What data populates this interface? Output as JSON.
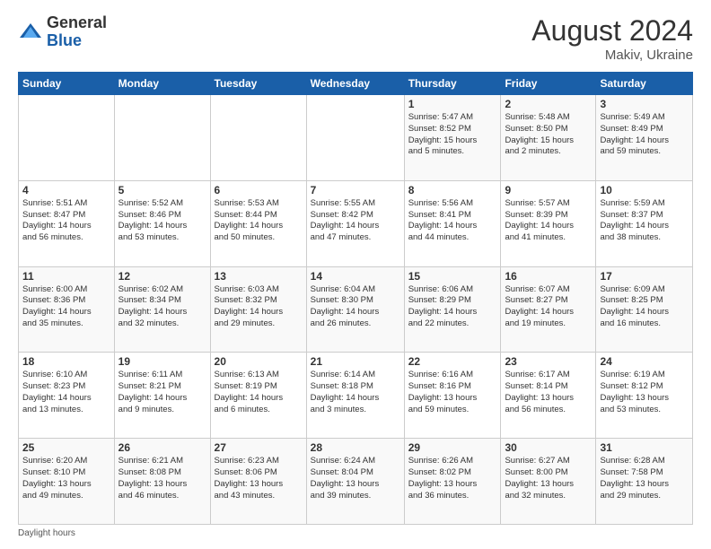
{
  "header": {
    "logo_general": "General",
    "logo_blue": "Blue",
    "month_year": "August 2024",
    "location": "Makiv, Ukraine"
  },
  "weekdays": [
    "Sunday",
    "Monday",
    "Tuesday",
    "Wednesday",
    "Thursday",
    "Friday",
    "Saturday"
  ],
  "weeks": [
    [
      {
        "day": "",
        "detail": ""
      },
      {
        "day": "",
        "detail": ""
      },
      {
        "day": "",
        "detail": ""
      },
      {
        "day": "",
        "detail": ""
      },
      {
        "day": "1",
        "detail": "Sunrise: 5:47 AM\nSunset: 8:52 PM\nDaylight: 15 hours\nand 5 minutes."
      },
      {
        "day": "2",
        "detail": "Sunrise: 5:48 AM\nSunset: 8:50 PM\nDaylight: 15 hours\nand 2 minutes."
      },
      {
        "day": "3",
        "detail": "Sunrise: 5:49 AM\nSunset: 8:49 PM\nDaylight: 14 hours\nand 59 minutes."
      }
    ],
    [
      {
        "day": "4",
        "detail": "Sunrise: 5:51 AM\nSunset: 8:47 PM\nDaylight: 14 hours\nand 56 minutes."
      },
      {
        "day": "5",
        "detail": "Sunrise: 5:52 AM\nSunset: 8:46 PM\nDaylight: 14 hours\nand 53 minutes."
      },
      {
        "day": "6",
        "detail": "Sunrise: 5:53 AM\nSunset: 8:44 PM\nDaylight: 14 hours\nand 50 minutes."
      },
      {
        "day": "7",
        "detail": "Sunrise: 5:55 AM\nSunset: 8:42 PM\nDaylight: 14 hours\nand 47 minutes."
      },
      {
        "day": "8",
        "detail": "Sunrise: 5:56 AM\nSunset: 8:41 PM\nDaylight: 14 hours\nand 44 minutes."
      },
      {
        "day": "9",
        "detail": "Sunrise: 5:57 AM\nSunset: 8:39 PM\nDaylight: 14 hours\nand 41 minutes."
      },
      {
        "day": "10",
        "detail": "Sunrise: 5:59 AM\nSunset: 8:37 PM\nDaylight: 14 hours\nand 38 minutes."
      }
    ],
    [
      {
        "day": "11",
        "detail": "Sunrise: 6:00 AM\nSunset: 8:36 PM\nDaylight: 14 hours\nand 35 minutes."
      },
      {
        "day": "12",
        "detail": "Sunrise: 6:02 AM\nSunset: 8:34 PM\nDaylight: 14 hours\nand 32 minutes."
      },
      {
        "day": "13",
        "detail": "Sunrise: 6:03 AM\nSunset: 8:32 PM\nDaylight: 14 hours\nand 29 minutes."
      },
      {
        "day": "14",
        "detail": "Sunrise: 6:04 AM\nSunset: 8:30 PM\nDaylight: 14 hours\nand 26 minutes."
      },
      {
        "day": "15",
        "detail": "Sunrise: 6:06 AM\nSunset: 8:29 PM\nDaylight: 14 hours\nand 22 minutes."
      },
      {
        "day": "16",
        "detail": "Sunrise: 6:07 AM\nSunset: 8:27 PM\nDaylight: 14 hours\nand 19 minutes."
      },
      {
        "day": "17",
        "detail": "Sunrise: 6:09 AM\nSunset: 8:25 PM\nDaylight: 14 hours\nand 16 minutes."
      }
    ],
    [
      {
        "day": "18",
        "detail": "Sunrise: 6:10 AM\nSunset: 8:23 PM\nDaylight: 14 hours\nand 13 minutes."
      },
      {
        "day": "19",
        "detail": "Sunrise: 6:11 AM\nSunset: 8:21 PM\nDaylight: 14 hours\nand 9 minutes."
      },
      {
        "day": "20",
        "detail": "Sunrise: 6:13 AM\nSunset: 8:19 PM\nDaylight: 14 hours\nand 6 minutes."
      },
      {
        "day": "21",
        "detail": "Sunrise: 6:14 AM\nSunset: 8:18 PM\nDaylight: 14 hours\nand 3 minutes."
      },
      {
        "day": "22",
        "detail": "Sunrise: 6:16 AM\nSunset: 8:16 PM\nDaylight: 13 hours\nand 59 minutes."
      },
      {
        "day": "23",
        "detail": "Sunrise: 6:17 AM\nSunset: 8:14 PM\nDaylight: 13 hours\nand 56 minutes."
      },
      {
        "day": "24",
        "detail": "Sunrise: 6:19 AM\nSunset: 8:12 PM\nDaylight: 13 hours\nand 53 minutes."
      }
    ],
    [
      {
        "day": "25",
        "detail": "Sunrise: 6:20 AM\nSunset: 8:10 PM\nDaylight: 13 hours\nand 49 minutes."
      },
      {
        "day": "26",
        "detail": "Sunrise: 6:21 AM\nSunset: 8:08 PM\nDaylight: 13 hours\nand 46 minutes."
      },
      {
        "day": "27",
        "detail": "Sunrise: 6:23 AM\nSunset: 8:06 PM\nDaylight: 13 hours\nand 43 minutes."
      },
      {
        "day": "28",
        "detail": "Sunrise: 6:24 AM\nSunset: 8:04 PM\nDaylight: 13 hours\nand 39 minutes."
      },
      {
        "day": "29",
        "detail": "Sunrise: 6:26 AM\nSunset: 8:02 PM\nDaylight: 13 hours\nand 36 minutes."
      },
      {
        "day": "30",
        "detail": "Sunrise: 6:27 AM\nSunset: 8:00 PM\nDaylight: 13 hours\nand 32 minutes."
      },
      {
        "day": "31",
        "detail": "Sunrise: 6:28 AM\nSunset: 7:58 PM\nDaylight: 13 hours\nand 29 minutes."
      }
    ]
  ],
  "footer": "Daylight hours"
}
